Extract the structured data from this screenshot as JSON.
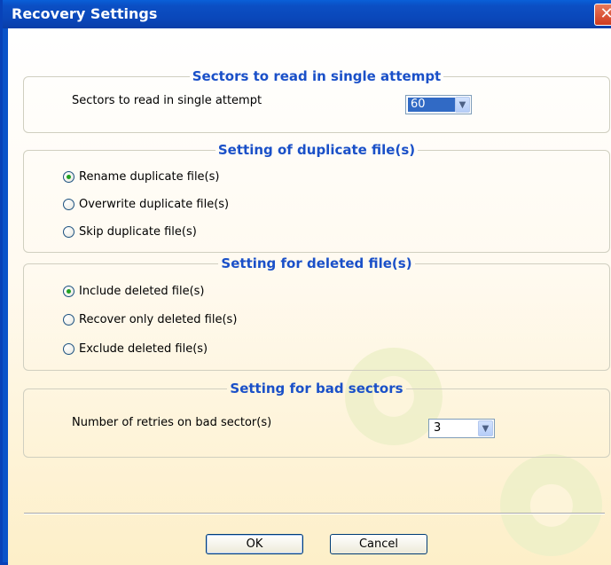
{
  "window": {
    "title": "Recovery Settings",
    "close_glyph": "✕"
  },
  "sectors": {
    "legend": "Sectors to read in single attempt",
    "label": "Sectors to read in single attempt",
    "value": "60"
  },
  "duplicate": {
    "legend": "Setting of duplicate file(s)",
    "options": [
      {
        "label": "Rename duplicate file(s)",
        "checked": true
      },
      {
        "label": "Overwrite duplicate file(s)",
        "checked": false
      },
      {
        "label": "Skip duplicate file(s)",
        "checked": false
      }
    ]
  },
  "deleted": {
    "legend": "Setting for deleted file(s)",
    "options": [
      {
        "label": "Include deleted file(s)",
        "checked": true
      },
      {
        "label": "Recover only deleted file(s)",
        "checked": false
      },
      {
        "label": "Exclude deleted file(s)",
        "checked": false
      }
    ]
  },
  "bad_sectors": {
    "legend": "Setting for bad sectors",
    "label": "Number of retries on bad sector(s)",
    "value": "3"
  },
  "buttons": {
    "ok": "OK",
    "cancel": "Cancel"
  },
  "icons": {
    "dropdown": "chevron-down-icon",
    "close": "close-icon",
    "background": "gear-icon"
  }
}
